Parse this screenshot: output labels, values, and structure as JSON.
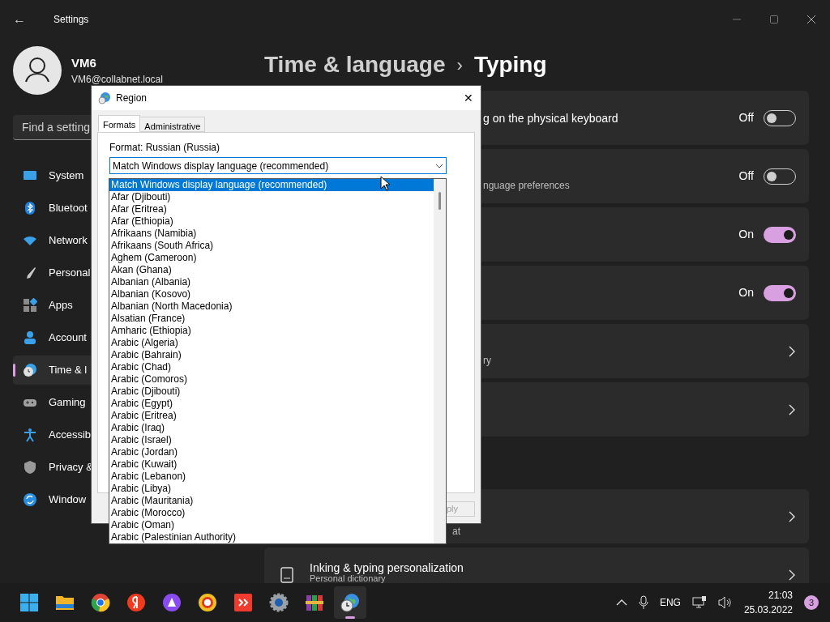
{
  "window": {
    "title": "Settings",
    "back": "←"
  },
  "user": {
    "name": "VM6",
    "email": "VM6@collabnet.local"
  },
  "search": {
    "placeholder": "Find a setting"
  },
  "sidebar": {
    "items": [
      {
        "label": "System",
        "selected": false
      },
      {
        "label": "Bluetoot",
        "selected": false
      },
      {
        "label": "Network",
        "selected": false
      },
      {
        "label": "Personal",
        "selected": false
      },
      {
        "label": "Apps",
        "selected": false
      },
      {
        "label": "Account",
        "selected": false
      },
      {
        "label": "Time & l",
        "selected": true
      },
      {
        "label": "Gaming",
        "selected": false
      },
      {
        "label": "Accessib",
        "selected": false
      },
      {
        "label": "Privacy &",
        "selected": false
      },
      {
        "label": "Window",
        "selected": false
      }
    ]
  },
  "breadcrumb": {
    "parent": "Time & language",
    "separator": "›",
    "current": "Typing"
  },
  "cards": [
    {
      "kind": "toggle",
      "title": "g on the physical keyboard",
      "state_label": "Off",
      "on": false
    },
    {
      "kind": "toggle",
      "subtitle": "nguage preferences",
      "state_label": "Off",
      "on": false
    },
    {
      "kind": "toggle",
      "state_label": "On",
      "on": true
    },
    {
      "kind": "toggle",
      "state_label": "On",
      "on": true
    },
    {
      "kind": "link",
      "subtitle": "ry"
    },
    {
      "kind": "link"
    },
    {
      "kind": "link",
      "subtitle": "at"
    },
    {
      "kind": "iconlink",
      "title": "Inking & typing personalization",
      "subtitle": "Personal dictionary"
    }
  ],
  "dialog": {
    "title": "Region",
    "close": "✕",
    "tabs": [
      {
        "label": "Formats",
        "selected": true
      },
      {
        "label": "Administrative",
        "selected": false
      }
    ],
    "format_label": "Format: Russian (Russia)",
    "combobox": {
      "value": "Match Windows display language (recommended)",
      "expanded": true
    },
    "apply_button": "ply",
    "options": [
      {
        "label": "Match Windows display language (recommended)",
        "selected": true
      },
      {
        "label": "Afar (Djibouti)",
        "selected": false
      },
      {
        "label": "Afar (Eritrea)",
        "selected": false
      },
      {
        "label": "Afar (Ethiopia)",
        "selected": false
      },
      {
        "label": "Afrikaans (Namibia)",
        "selected": false
      },
      {
        "label": "Afrikaans (South Africa)",
        "selected": false
      },
      {
        "label": "Aghem (Cameroon)",
        "selected": false
      },
      {
        "label": "Akan (Ghana)",
        "selected": false
      },
      {
        "label": "Albanian (Albania)",
        "selected": false
      },
      {
        "label": "Albanian (Kosovo)",
        "selected": false
      },
      {
        "label": "Albanian (North Macedonia)",
        "selected": false
      },
      {
        "label": "Alsatian (France)",
        "selected": false
      },
      {
        "label": "Amharic (Ethiopia)",
        "selected": false
      },
      {
        "label": "Arabic (Algeria)",
        "selected": false
      },
      {
        "label": "Arabic (Bahrain)",
        "selected": false
      },
      {
        "label": "Arabic (Chad)",
        "selected": false
      },
      {
        "label": "Arabic (Comoros)",
        "selected": false
      },
      {
        "label": "Arabic (Djibouti)",
        "selected": false
      },
      {
        "label": "Arabic (Egypt)",
        "selected": false
      },
      {
        "label": "Arabic (Eritrea)",
        "selected": false
      },
      {
        "label": "Arabic (Iraq)",
        "selected": false
      },
      {
        "label": "Arabic (Israel)",
        "selected": false
      },
      {
        "label": "Arabic (Jordan)",
        "selected": false
      },
      {
        "label": "Arabic (Kuwait)",
        "selected": false
      },
      {
        "label": "Arabic (Lebanon)",
        "selected": false
      },
      {
        "label": "Arabic (Libya)",
        "selected": false
      },
      {
        "label": "Arabic (Mauritania)",
        "selected": false
      },
      {
        "label": "Arabic (Morocco)",
        "selected": false
      },
      {
        "label": "Arabic (Oman)",
        "selected": false
      },
      {
        "label": "Arabic (Palestinian Authority)",
        "selected": false
      }
    ]
  },
  "taskbar": {
    "apps": [
      {
        "active": false
      },
      {
        "active": false
      },
      {
        "active": false
      },
      {
        "active": false
      },
      {
        "active": false
      },
      {
        "active": false
      },
      {
        "active": false
      },
      {
        "active": false
      },
      {
        "active": false
      },
      {
        "active": true
      }
    ],
    "language": "ENG",
    "time": "21:03",
    "date": "25.03.2022",
    "notifications": "3"
  }
}
